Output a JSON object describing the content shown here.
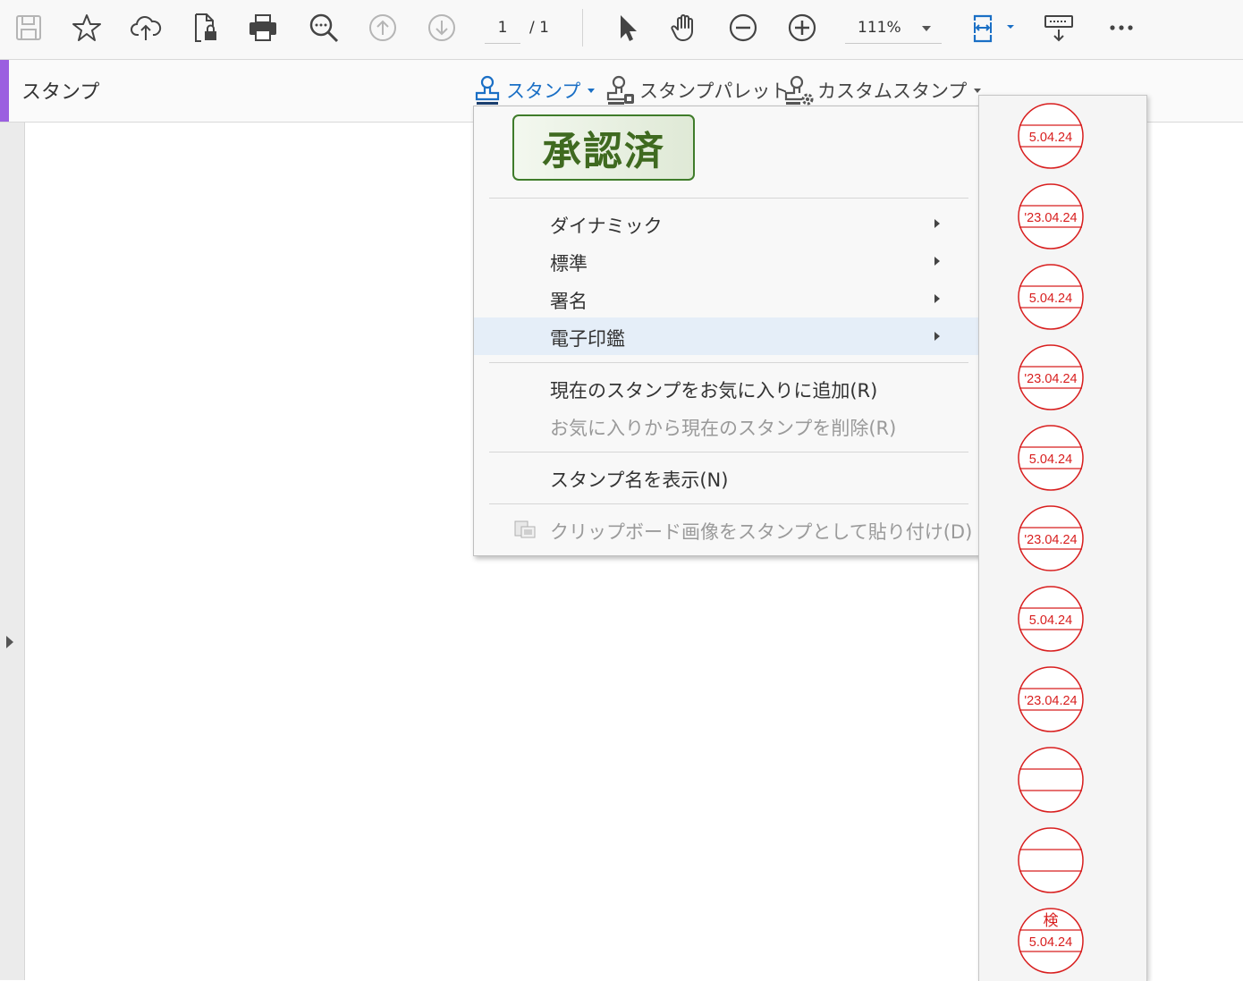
{
  "toolbar": {
    "page_current": "1",
    "page_total": "/ 1",
    "zoom": "111%"
  },
  "subbar": {
    "title": "スタンプ",
    "stamp_menu": "スタンプ",
    "stamp_palette": "スタンプパレット",
    "custom_stamp": "カスタムスタンプ"
  },
  "menu": {
    "preview_label": "承認済",
    "items": [
      {
        "label": "ダイナミック"
      },
      {
        "label": "標準"
      },
      {
        "label": "署名"
      },
      {
        "label": "電子印鑑"
      }
    ],
    "add_favorite": "現在のスタンプをお気に入りに追加(R)",
    "remove_favorite": "お気に入りから現在のスタンプを削除(R)",
    "show_names": "スタンプ名を表示(N)",
    "paste_clipboard": "クリップボード画像をスタンプとして貼り付け(D)"
  },
  "seals": [
    {
      "date": "5.04.24"
    },
    {
      "date": "'23.04.24"
    },
    {
      "date": "5.04.24"
    },
    {
      "date": "'23.04.24"
    },
    {
      "date": "5.04.24"
    },
    {
      "date": "'23.04.24"
    },
    {
      "date": "5.04.24"
    },
    {
      "date": "'23.04.24"
    },
    {
      "date": ""
    },
    {
      "date": ""
    },
    {
      "top": "検",
      "date": "5.04.24"
    }
  ],
  "colors": {
    "accent": "#9b5fe0",
    "active_blue": "#1a6fc5",
    "seal_red": "#d81e1e",
    "stamp_green": "#3f6a20",
    "highlight": "#e5eef8"
  }
}
